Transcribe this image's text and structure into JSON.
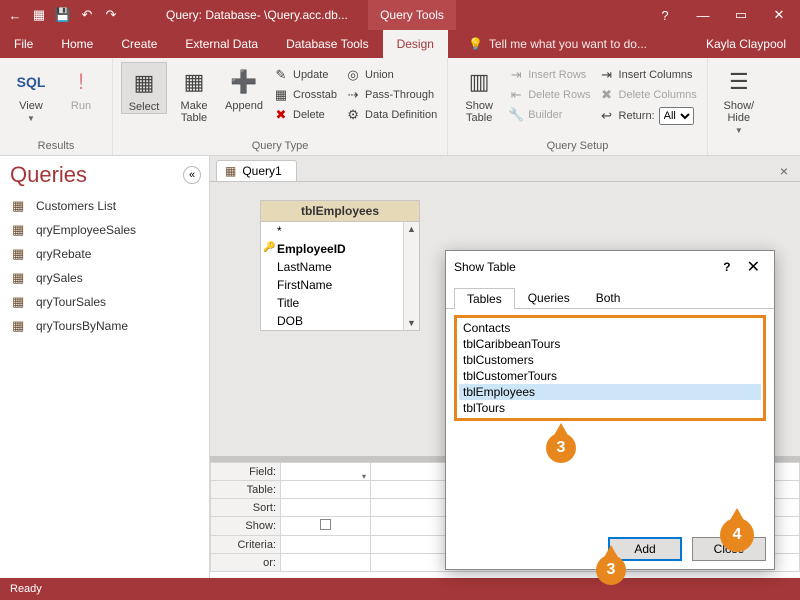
{
  "titlebar": {
    "title": "Query: Database- \\Query.acc.db...",
    "tool_tab": "Query Tools",
    "help": "?",
    "user": "Kayla Claypool"
  },
  "menu": {
    "items": [
      "File",
      "Home",
      "Create",
      "External Data",
      "Database Tools",
      "Design"
    ],
    "active_index": 5,
    "tell_me": "Tell me what you want to do..."
  },
  "ribbon": {
    "results": {
      "view": "View",
      "run": "Run",
      "sql": "SQL",
      "label": "Results"
    },
    "query_type": {
      "select": "Select",
      "make_table": "Make\nTable",
      "append": "Append",
      "update": "Update",
      "crosstab": "Crosstab",
      "delete": "Delete",
      "union": "Union",
      "pass_through": "Pass-Through",
      "data_def": "Data Definition",
      "label": "Query Type"
    },
    "show_table": "Show\nTable",
    "query_setup": {
      "insert_rows": "Insert Rows",
      "delete_rows": "Delete Rows",
      "builder": "Builder",
      "insert_cols": "Insert Columns",
      "delete_cols": "Delete Columns",
      "return": "Return:",
      "return_value": "All",
      "label": "Query Setup"
    },
    "show_hide": "Show/\nHide"
  },
  "nav": {
    "header": "Queries",
    "items": [
      "Customers List",
      "qryEmployeeSales",
      "qryRebate",
      "qrySales",
      "qryTourSales",
      "qryToursByName"
    ]
  },
  "doc_tab": "Query1",
  "table_box": {
    "title": "tblEmployees",
    "fields": [
      "*",
      "EmployeeID",
      "LastName",
      "FirstName",
      "Title",
      "DOB"
    ],
    "key_index": 1
  },
  "grid": {
    "rows": [
      "Field:",
      "Table:",
      "Sort:",
      "Show:",
      "Criteria:",
      "or:"
    ]
  },
  "dialog": {
    "title": "Show Table",
    "tabs": [
      "Tables",
      "Queries",
      "Both"
    ],
    "active_tab": 0,
    "items": [
      "Contacts",
      "tblCaribbeanTours",
      "tblCustomers",
      "tblCustomerTours",
      "tblEmployees",
      "tblTours"
    ],
    "selected_index": 4,
    "add": "Add",
    "close": "Close"
  },
  "callouts": {
    "c3": "3",
    "c4": "4"
  },
  "status": "Ready"
}
